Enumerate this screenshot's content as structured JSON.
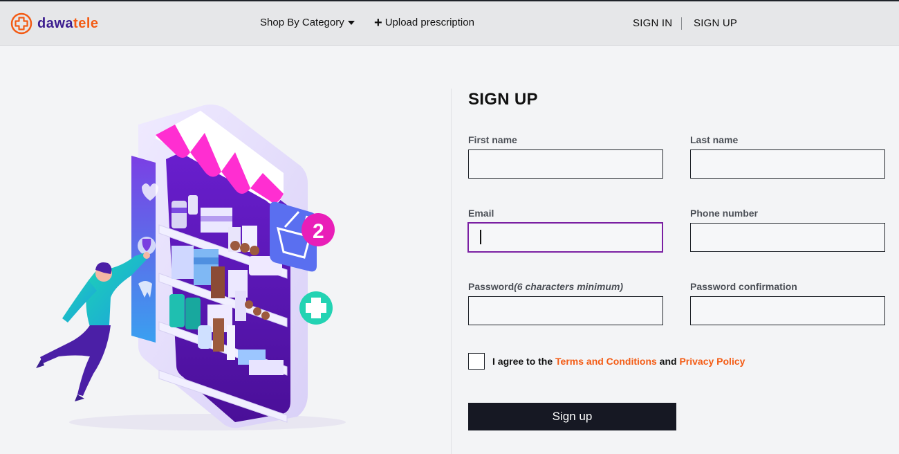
{
  "brand": {
    "name_part1": "dawa",
    "name_part2": "tele",
    "color_primary": "#3b1d8f",
    "color_accent": "#f35b14"
  },
  "nav": {
    "shop_by_category": "Shop By Category",
    "upload_prescription": "Upload prescription",
    "sign_in": "SIGN IN",
    "sign_up": "SIGN UP"
  },
  "illustration": {
    "badge_number": "2"
  },
  "form": {
    "title": "SIGN UP",
    "first_name_label": "First name",
    "last_name_label": "Last name",
    "email_label": "Email",
    "phone_label": "Phone number",
    "password_label": "Password",
    "password_hint": "(6 characters minimum)",
    "password_confirm_label": "Password confirmation",
    "first_name_value": "",
    "last_name_value": "",
    "email_value": "",
    "phone_value": "",
    "password_value": "",
    "password_confirm_value": "",
    "agree_prefix": "I agree to the ",
    "terms_link": "Terms and Conditions",
    "agree_and": " and ",
    "privacy_link": "Privacy Policy",
    "submit_label": "Sign up",
    "terms_checked": false
  }
}
